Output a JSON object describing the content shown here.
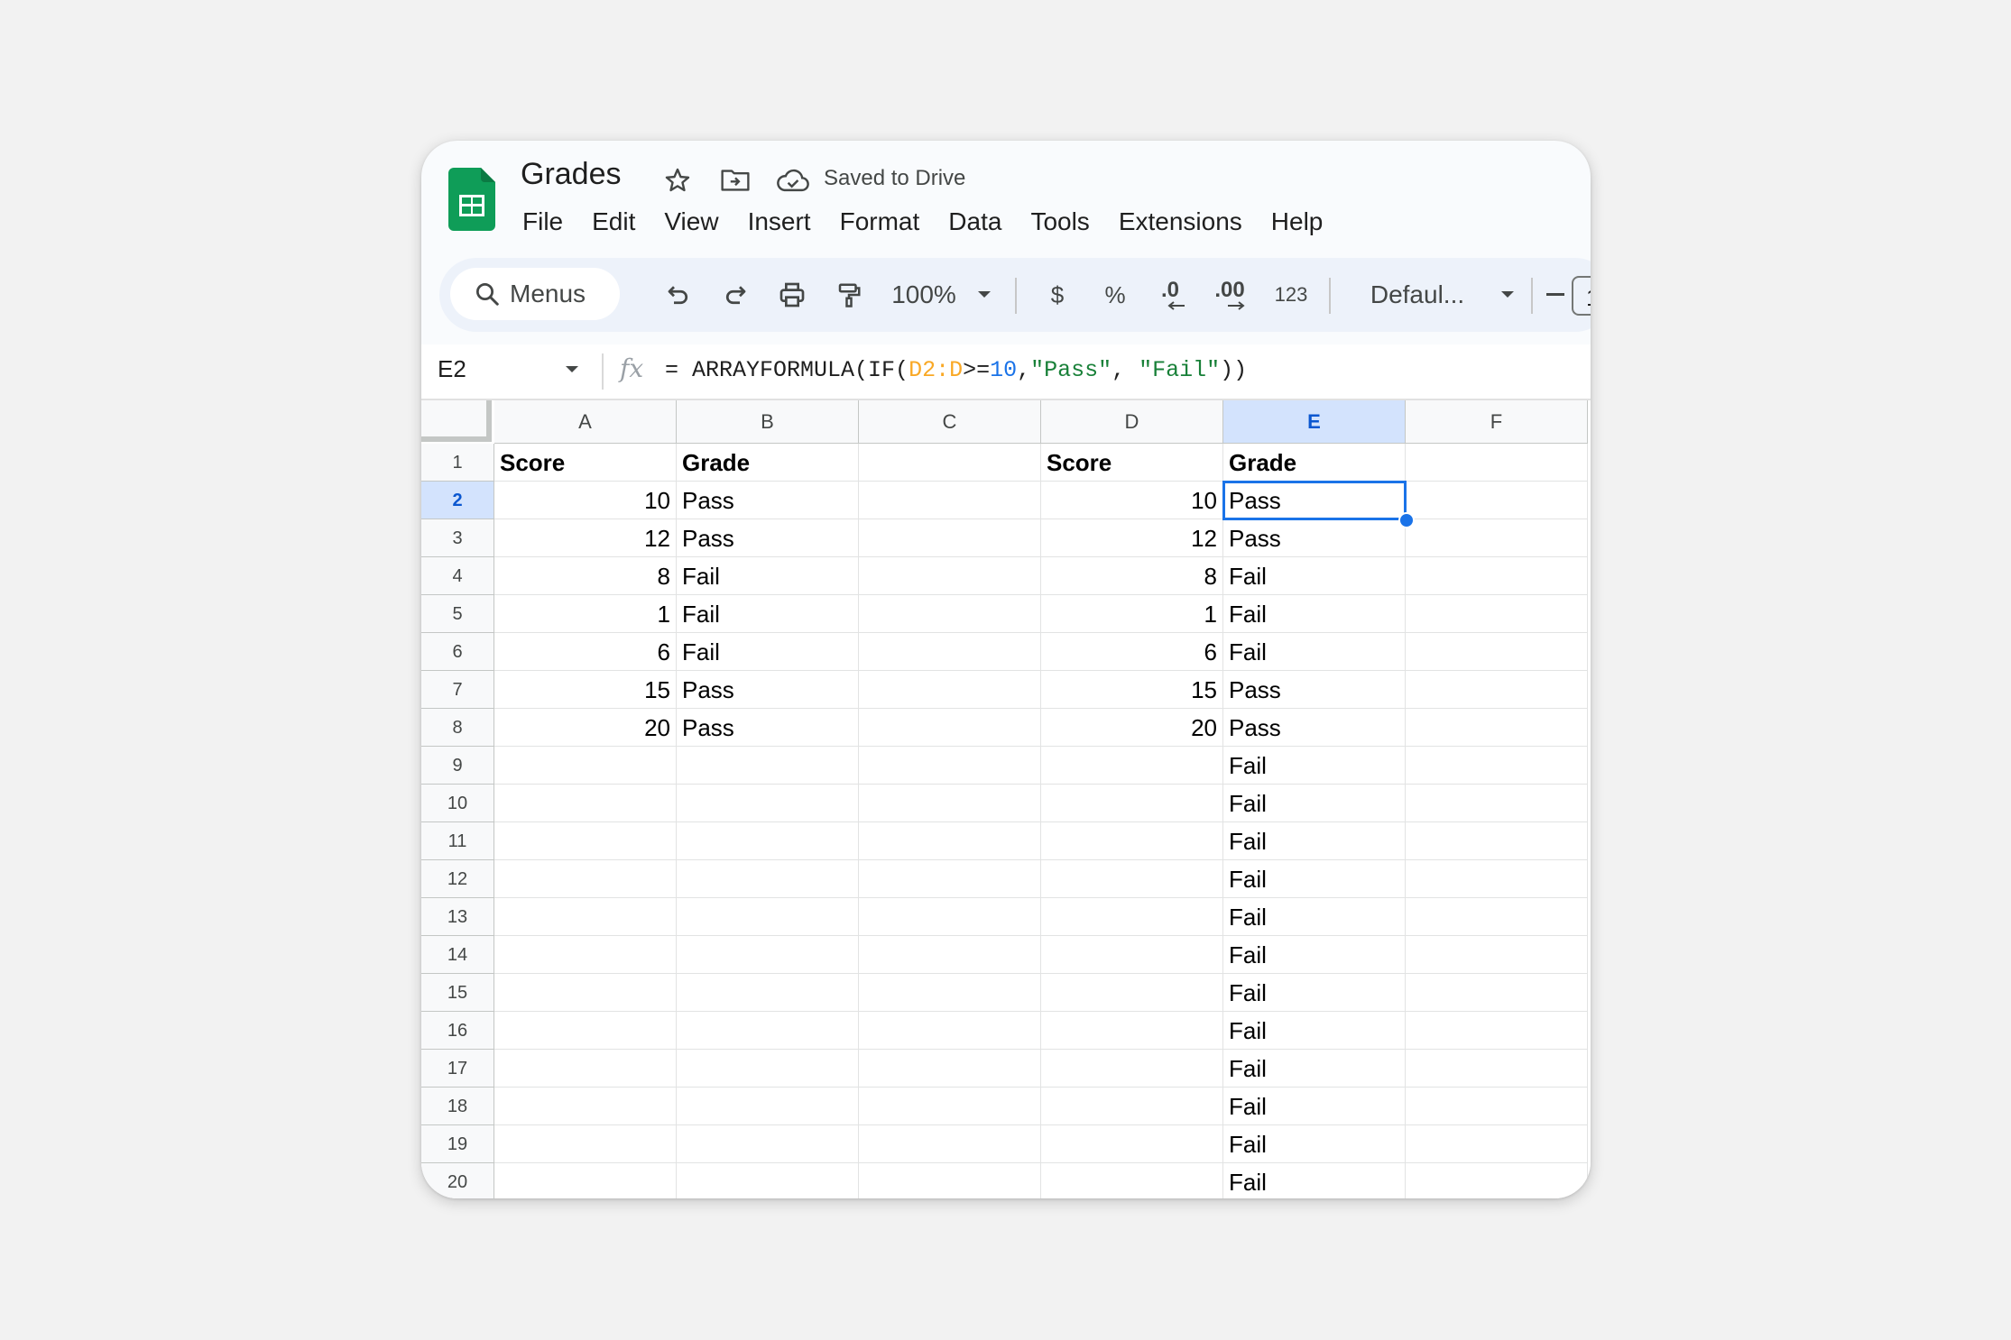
{
  "doc": {
    "title": "Grades",
    "save_status": "Saved to Drive"
  },
  "menus": [
    "File",
    "Edit",
    "View",
    "Insert",
    "Format",
    "Data",
    "Tools",
    "Extensions",
    "Help"
  ],
  "toolbar": {
    "search_label": "Menus",
    "zoom": "100%",
    "currency": "$",
    "percent": "%",
    "decrease_decimal": ".0",
    "increase_decimal": ".00",
    "more_formats": "123",
    "font": "Defaul...",
    "font_size": "1"
  },
  "formula_bar": {
    "name_box": "E2",
    "eq": "= ",
    "f1": "ARRAYFORMULA(IF(",
    "range": "D2:D",
    "op": ">=",
    "num": "10",
    "comma1": ",",
    "s1": "\"Pass\"",
    "comma2": ", ",
    "s2": "\"Fail\"",
    "close": "))"
  },
  "columns": [
    "A",
    "B",
    "C",
    "D",
    "E",
    "F"
  ],
  "selected_column": "E",
  "selected_row": 2,
  "rows": [
    [
      "Score",
      "Grade",
      "",
      "Score",
      "Grade",
      ""
    ],
    [
      "10",
      "Pass",
      "",
      "10",
      "Pass",
      ""
    ],
    [
      "12",
      "Pass",
      "",
      "12",
      "Pass",
      ""
    ],
    [
      "8",
      "Fail",
      "",
      "8",
      "Fail",
      ""
    ],
    [
      "1",
      "Fail",
      "",
      "1",
      "Fail",
      ""
    ],
    [
      "6",
      "Fail",
      "",
      "6",
      "Fail",
      ""
    ],
    [
      "15",
      "Pass",
      "",
      "15",
      "Pass",
      ""
    ],
    [
      "20",
      "Pass",
      "",
      "20",
      "Pass",
      ""
    ],
    [
      "",
      "",
      "",
      "",
      "Fail",
      ""
    ],
    [
      "",
      "",
      "",
      "",
      "Fail",
      ""
    ],
    [
      "",
      "",
      "",
      "",
      "Fail",
      ""
    ],
    [
      "",
      "",
      "",
      "",
      "Fail",
      ""
    ],
    [
      "",
      "",
      "",
      "",
      "Fail",
      ""
    ],
    [
      "",
      "",
      "",
      "",
      "Fail",
      ""
    ],
    [
      "",
      "",
      "",
      "",
      "Fail",
      ""
    ],
    [
      "",
      "",
      "",
      "",
      "Fail",
      ""
    ],
    [
      "",
      "",
      "",
      "",
      "Fail",
      ""
    ],
    [
      "",
      "",
      "",
      "",
      "Fail",
      ""
    ],
    [
      "",
      "",
      "",
      "",
      "Fail",
      ""
    ],
    [
      "",
      "",
      "",
      "",
      "Fail",
      ""
    ]
  ],
  "row_numbers": [
    "1",
    "2",
    "3",
    "4",
    "5",
    "6",
    "7",
    "8",
    "9",
    "10",
    "11",
    "12",
    "13",
    "14",
    "15",
    "16",
    "17",
    "18",
    "19",
    "20"
  ]
}
